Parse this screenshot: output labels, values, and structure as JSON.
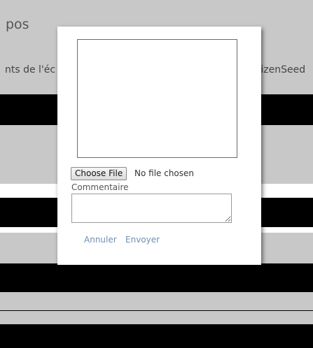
{
  "page": {
    "title": "pos",
    "subtitle": "nts de l'éc",
    "side_text": "itizenSeed",
    "colors": {
      "background_gray": "#c8c8c8",
      "band_black": "#000000",
      "link_blue": "#6f8fb5"
    }
  },
  "modal": {
    "file_button_label": "Choose File",
    "file_status": "No file chosen",
    "comment_label": "Commentaire",
    "comment_value": "",
    "cancel_label": "Annuler",
    "send_label": "Envoyer"
  }
}
